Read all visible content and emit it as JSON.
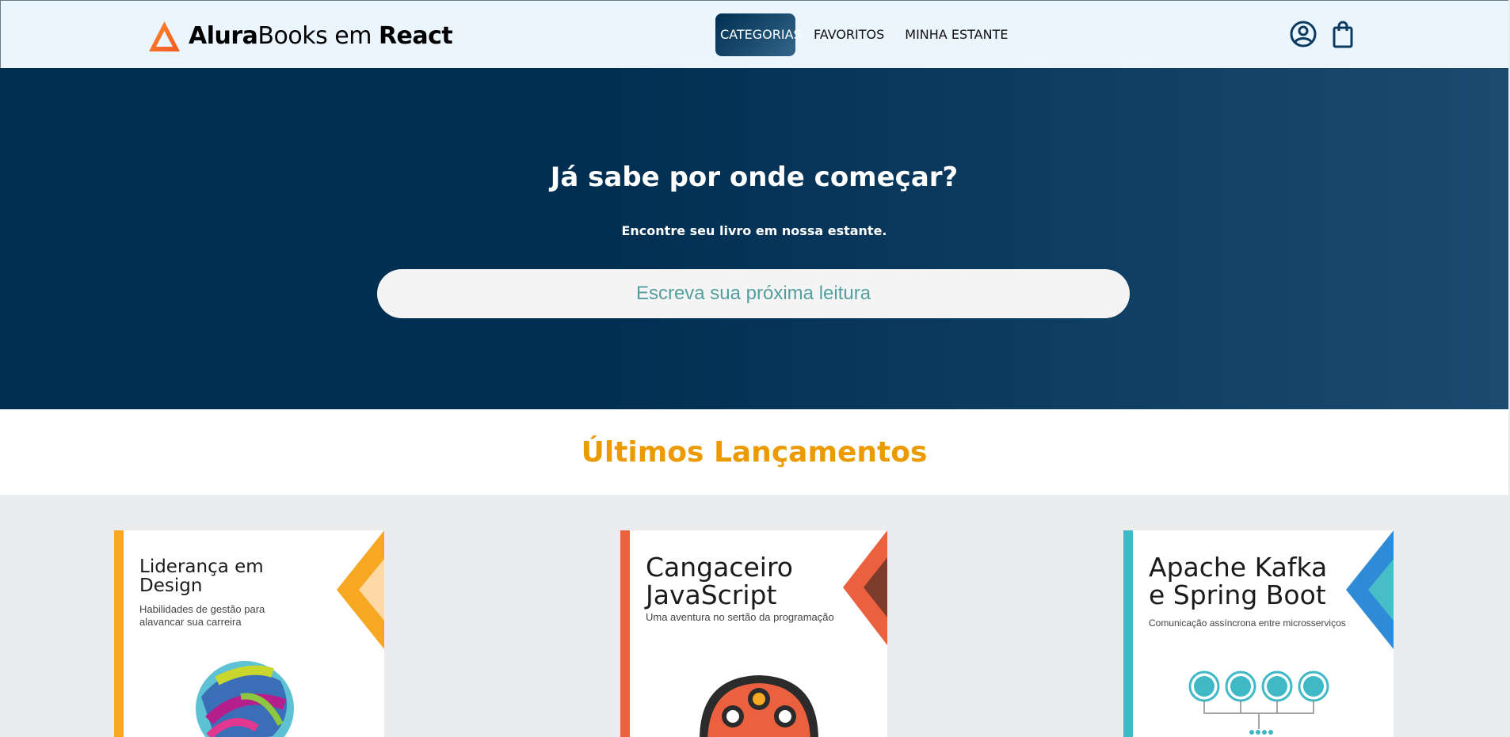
{
  "header": {
    "logo": {
      "brand_bold": "Alura",
      "brand_regular": "Books em ",
      "brand_react": "React"
    },
    "nav": [
      {
        "label": "CATEGORIAS"
      },
      {
        "label": "FAVORITOS"
      },
      {
        "label": "MINHA ESTANTE"
      }
    ],
    "icons": [
      "user-icon",
      "shopping-bag-icon"
    ]
  },
  "hero": {
    "title": "Já sabe por onde começar?",
    "subtitle": "Encontre seu livro em nossa estante.",
    "search_placeholder": "Escreva sua próxima leitura"
  },
  "releases": {
    "title": "Últimos Lançamentos"
  },
  "books": [
    {
      "title": "Liderança em\nDesign",
      "subtitle": "Habilidades de gestão para\nalavancar sua carreira",
      "accent": "#f6a823"
    },
    {
      "title": "Cangaceiro\nJavaScript",
      "subtitle": "Uma aventura no sertão da programação",
      "accent": "#eb613f"
    },
    {
      "title": "Apache Kafka\ne Spring Boot",
      "subtitle": "Comunicação assíncrona entre microsserviços",
      "accent": "#3fb9c5"
    }
  ],
  "colors": {
    "accent_orange": "#eb9b00",
    "hero_dark": "#002f52",
    "header_bg": "#ebf5fe"
  }
}
